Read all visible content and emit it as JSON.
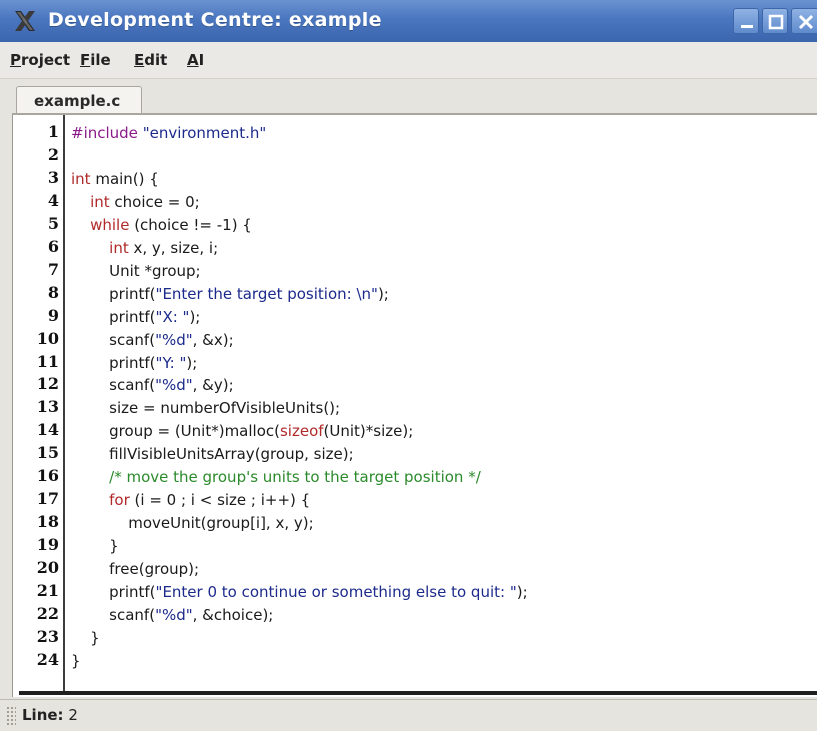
{
  "window": {
    "title": "Development Centre: example"
  },
  "menu": {
    "project": {
      "mnemonic": "P",
      "rest": "roject"
    },
    "file": {
      "mnemonic": "F",
      "rest": "ile"
    },
    "edit": {
      "mnemonic": "E",
      "rest": "dit"
    },
    "ai": {
      "mnemonic": "A",
      "rest": "I"
    }
  },
  "tabs": [
    {
      "label": "example.c"
    }
  ],
  "status": {
    "label": "Line:",
    "value": "2"
  },
  "colors": {
    "keyword": "#b02a2a",
    "string": "#1c2a8c",
    "preprocessor": "#8b1a8b",
    "comment": "#2b8a2b",
    "titlebar": "#4a76bf"
  },
  "icons": {
    "app": "x-logo-icon",
    "minimize": "minimize-icon",
    "maximize": "maximize-icon",
    "close": "close-icon"
  },
  "code": {
    "line_numbers": [
      "1",
      "2",
      "3",
      "4",
      "5",
      "6",
      "7",
      "8",
      "9",
      "10",
      "11",
      "12",
      "13",
      "14",
      "15",
      "16",
      "17",
      "18",
      "19",
      "20",
      "21",
      "22",
      "23",
      "24"
    ],
    "lines": [
      [
        {
          "t": "#include ",
          "c": "pre"
        },
        {
          "t": "\"environment.h\"",
          "c": "str"
        }
      ],
      [],
      [
        {
          "t": "int",
          "c": "kw"
        },
        {
          "t": " main() {",
          "c": ""
        }
      ],
      [
        {
          "t": "\t",
          "c": ""
        },
        {
          "t": "int",
          "c": "kw"
        },
        {
          "t": " choice = 0;",
          "c": ""
        }
      ],
      [
        {
          "t": "\t",
          "c": ""
        },
        {
          "t": "while",
          "c": "kw"
        },
        {
          "t": " (choice != -1) {",
          "c": ""
        }
      ],
      [
        {
          "t": "\t\t",
          "c": ""
        },
        {
          "t": "int",
          "c": "kw"
        },
        {
          "t": " x, y, size, i;",
          "c": ""
        }
      ],
      [
        {
          "t": "\t\tUnit *group;",
          "c": ""
        }
      ],
      [
        {
          "t": "\t\tprintf(",
          "c": ""
        },
        {
          "t": "\"Enter the target position: \\n\"",
          "c": "str"
        },
        {
          "t": ");",
          "c": ""
        }
      ],
      [
        {
          "t": "\t\tprintf(",
          "c": ""
        },
        {
          "t": "\"X: \"",
          "c": "str"
        },
        {
          "t": ");",
          "c": ""
        }
      ],
      [
        {
          "t": "\t\tscanf(",
          "c": ""
        },
        {
          "t": "\"%d\"",
          "c": "str"
        },
        {
          "t": ", &x);",
          "c": ""
        }
      ],
      [
        {
          "t": "\t\tprintf(",
          "c": ""
        },
        {
          "t": "\"Y: \"",
          "c": "str"
        },
        {
          "t": ");",
          "c": ""
        }
      ],
      [
        {
          "t": "\t\tscanf(",
          "c": ""
        },
        {
          "t": "\"%d\"",
          "c": "str"
        },
        {
          "t": ", &y);",
          "c": ""
        }
      ],
      [
        {
          "t": "\t\tsize = numberOfVisibleUnits();",
          "c": ""
        }
      ],
      [
        {
          "t": "\t\tgroup = (Unit*)malloc(",
          "c": ""
        },
        {
          "t": "sizeof",
          "c": "kw"
        },
        {
          "t": "(Unit)*size);",
          "c": ""
        }
      ],
      [
        {
          "t": "\t\tfillVisibleUnitsArray(group, size);",
          "c": ""
        }
      ],
      [
        {
          "t": "\t\t",
          "c": ""
        },
        {
          "t": "/* move the group's units to the target position */",
          "c": "cmt"
        }
      ],
      [
        {
          "t": "\t\t",
          "c": ""
        },
        {
          "t": "for",
          "c": "kw"
        },
        {
          "t": " (i = 0 ; i < size ; i++) {",
          "c": ""
        }
      ],
      [
        {
          "t": "\t\t\tmoveUnit(group[i], x, y);",
          "c": ""
        }
      ],
      [
        {
          "t": "\t\t}",
          "c": ""
        }
      ],
      [
        {
          "t": "\t\tfree(group);",
          "c": ""
        }
      ],
      [
        {
          "t": "\t\tprintf(",
          "c": ""
        },
        {
          "t": "\"Enter 0 to continue or something else to quit: \"",
          "c": "str"
        },
        {
          "t": ");",
          "c": ""
        }
      ],
      [
        {
          "t": "\t\tscanf(",
          "c": ""
        },
        {
          "t": "\"%d\"",
          "c": "str"
        },
        {
          "t": ", &choice);",
          "c": ""
        }
      ],
      [
        {
          "t": "\t}",
          "c": ""
        }
      ],
      [
        {
          "t": "}",
          "c": ""
        }
      ]
    ]
  }
}
